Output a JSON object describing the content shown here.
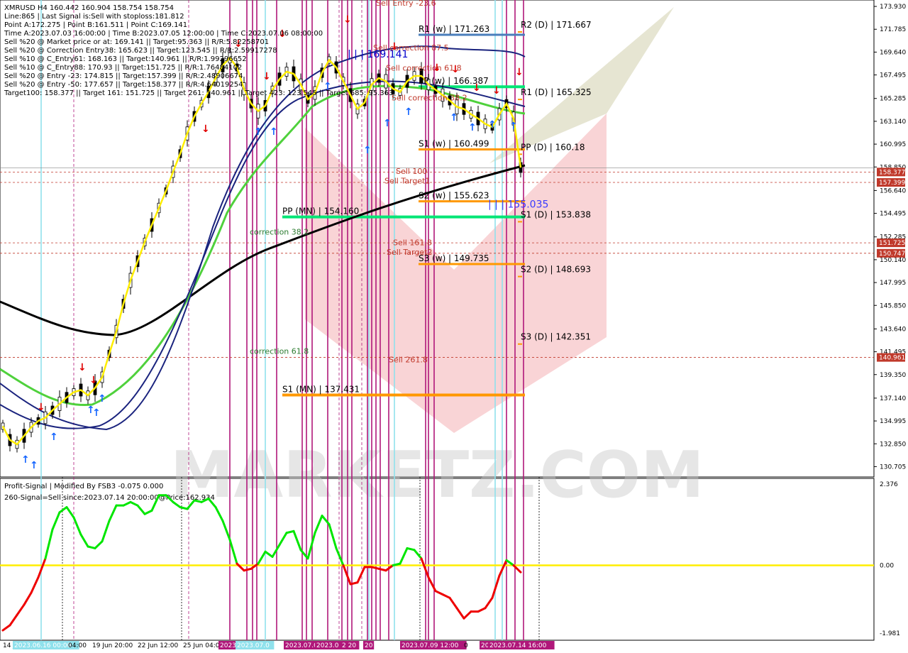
{
  "header": {
    "symbol_line": "XMRUSD H4  160.442 160.904 158.754 158.754",
    "info_lines": [
      "Line:865 | Last Signal is:Sell with stoploss:181.812",
      "Point A:172.275 | Point B:161.511 | Point C:169.141",
      "Time A:2023.07.03 16:00:00 | Time B:2023.07.05 12:00:00 | Time C:2023.07.06 08:00:00",
      "Sell %20 @ Market price or at: 169.141 || Target:95.363 || R/R:5.82258701",
      "Sell %20 @ Correction Entry38: 165.623 || Target:123.545 || R/R:2.59917278",
      "Sell %10 @ C_Entry61: 168.163 || Target:140.961 || R/R:1.99296652",
      "Sell %10 @ C_Entry88: 170.93 || Target:151.725 || R/R:1.76484102",
      "Sell %20 @ Entry -23: 174.815 || Target:157.399 || R/R:2.48906674",
      "Sell %20 @ Entry -50: 177.657 || Target:158.377 || R/R:4.64019254",
      "Target100: 158.377 || Target 161: 151.725 || Target 261: 140.961 || Target 423: 123.545 || Target 685: 95.363"
    ]
  },
  "chart_data": [
    {
      "type": "line",
      "title": "XMRUSD H4",
      "ylim": [
        130.0,
        174.0
      ],
      "y_ticks": [
        "173.930",
        "171.785",
        "169.640",
        "167.495",
        "165.285",
        "163.140",
        "160.995",
        "158.850",
        "156.640",
        "154.495",
        "152.285",
        "150.140",
        "147.995",
        "145.850",
        "143.640",
        "141.495",
        "139.350",
        "137.140",
        "134.995",
        "132.850",
        "130.705"
      ],
      "x_tick_labels": [
        "14 Jun",
        "2023.06.16 00:00",
        "04:00",
        "19 Jun 20:00",
        "22 Jun 12:00",
        "25 Jun 04:00",
        "2023",
        "2023.07.0",
        "2023.07.0",
        "2023.0",
        "2 20",
        "20",
        "2023.07.09 12:00",
        "0",
        "20",
        "2023.07.14 16:00"
      ],
      "price_tags": [
        {
          "label": "158.377",
          "value": 158.377,
          "color": "#c0392b"
        },
        {
          "label": "157.399",
          "value": 157.399,
          "color": "#c0392b"
        },
        {
          "label": "151.725",
          "value": 151.725,
          "color": "#c0392b"
        },
        {
          "label": "150.747",
          "value": 150.747,
          "color": "#c0392b"
        },
        {
          "label": "140.961",
          "value": 140.961,
          "color": "#c0392b"
        }
      ],
      "levels": [
        {
          "label": "R2 (D) | 171.667",
          "value": 171.667,
          "color": "#000000"
        },
        {
          "label": "R1 (w) | 171.263",
          "value": 171.263,
          "color": "#4a7ebb"
        },
        {
          "label": "PP (w) | 166.387",
          "value": 166.387,
          "color": "#00e676"
        },
        {
          "label": "R1 (D) | 165.325",
          "value": 165.325,
          "color": "#000000"
        },
        {
          "label": "S1 (w) | 160.499",
          "value": 160.499,
          "color": "#ff9800"
        },
        {
          "label": "PP (D) | 160.18",
          "value": 160.18,
          "color": "#000000"
        },
        {
          "label": "S2 (w) | 155.623",
          "value": 155.623,
          "color": "#ff9800"
        },
        {
          "label": "PP (MN) | 154.160",
          "value": 154.16,
          "color": "#00e676"
        },
        {
          "label": "S1 (D) | 153.838",
          "value": 153.838,
          "color": "#000000"
        },
        {
          "label": "S3 (w) | 149.735",
          "value": 149.735,
          "color": "#ff9800"
        },
        {
          "label": "S2 (D) | 148.693",
          "value": 148.693,
          "color": "#000000"
        },
        {
          "label": "S3 (D) | 142.351",
          "value": 142.351,
          "color": "#000000"
        },
        {
          "label": "S1 (MN) | 137.431",
          "value": 137.431,
          "color": "#ff9800"
        }
      ],
      "annotations": [
        {
          "text": "| | | 169.141",
          "value": 169.141,
          "color": "#0000cc"
        },
        {
          "text": "| | | 155.035",
          "value": 155.035,
          "color": "#0000cc"
        },
        {
          "text": "Sell Entry -23.6",
          "value": 174.0,
          "color": "#c0392b"
        },
        {
          "text": "Sell correction 87.5",
          "value": 169.8,
          "color": "#c0392b"
        },
        {
          "text": "Sell correction 61.8",
          "value": 167.9,
          "color": "#c0392b"
        },
        {
          "text": "Sell correction 38.2",
          "value": 165.1,
          "color": "#c0392b"
        },
        {
          "text": "Sell 100",
          "value": 158.2,
          "color": "#c0392b"
        },
        {
          "text": "Sell Target1",
          "value": 157.3,
          "color": "#c0392b"
        },
        {
          "text": "Sell 161.8",
          "value": 151.5,
          "color": "#c0392b"
        },
        {
          "text": "Sell Target2",
          "value": 150.6,
          "color": "#c0392b"
        },
        {
          "text": "Sell 261.8",
          "value": 140.5,
          "color": "#c0392b"
        },
        {
          "text": "correction 38.2",
          "value": 152.5,
          "color": "#2e7d32"
        },
        {
          "text": "correction 61.8",
          "value": 141.3,
          "color": "#2e7d32"
        }
      ],
      "series": [
        {
          "name": "XMRUSD H4",
          "color": "#ffee00",
          "x": [
            0,
            10,
            20,
            30,
            40,
            50,
            60,
            70,
            80,
            90,
            100,
            110,
            120,
            130,
            140,
            150,
            160,
            170,
            180,
            190,
            200,
            210,
            220,
            230,
            240,
            250,
            260,
            270,
            280,
            290,
            300,
            310,
            320,
            330,
            340,
            350,
            360,
            370,
            380,
            390,
            400,
            410,
            420,
            430,
            440,
            450,
            460,
            470,
            480,
            490,
            500,
            510,
            520,
            530,
            540,
            550,
            560,
            570,
            580,
            590,
            600,
            610,
            620,
            630,
            640,
            650,
            660,
            670,
            680,
            690,
            700,
            710,
            720,
            730
          ],
          "values": [
            134.5,
            133.2,
            132.8,
            133.6,
            134.4,
            135.0,
            135.3,
            136.0,
            136.6,
            137.2,
            137.7,
            137.9,
            137.4,
            138.1,
            139.1,
            141.3,
            143.4,
            146.0,
            148.2,
            150.0,
            151.8,
            153.4,
            155.0,
            156.6,
            158.4,
            160.1,
            162.0,
            163.6,
            164.8,
            165.9,
            167.2,
            168.4,
            169.1,
            168.2,
            166.2,
            164.8,
            164.1,
            164.6,
            166.1,
            167.1,
            167.8,
            167.6,
            166.6,
            165.2,
            165.8,
            167.7,
            168.9,
            168.2,
            166.9,
            165.6,
            164.3,
            164.9,
            166.6,
            167.2,
            166.9,
            166.2,
            165.9,
            166.9,
            167.4,
            167.4,
            166.6,
            166.1,
            165.6,
            165.1,
            164.5,
            164.3,
            163.8,
            163.4,
            162.9,
            162.6,
            163.8,
            164.8,
            163.4,
            158.8
          ]
        },
        {
          "name": "Profit-Signal",
          "color": "#00e600",
          "x": [
            0,
            10,
            20,
            30,
            40,
            50,
            60,
            70,
            80,
            90,
            100,
            110,
            120,
            130,
            140,
            150,
            160,
            170,
            180,
            190,
            200,
            210,
            220,
            230,
            240,
            250,
            260,
            270,
            280,
            290,
            300,
            310,
            320,
            330,
            340,
            350,
            360,
            370,
            380,
            390,
            400,
            410,
            420,
            430,
            440,
            450,
            460,
            470,
            480,
            490,
            500,
            510,
            520,
            530,
            540,
            550,
            560,
            570,
            580,
            590,
            600,
            610,
            620,
            630,
            640,
            650,
            660,
            670,
            680,
            690,
            700,
            710,
            720,
            730
          ],
          "values": [
            -1.9,
            -1.75,
            -1.45,
            -1.15,
            -0.8,
            -0.35,
            0.2,
            1.05,
            1.55,
            1.7,
            1.4,
            0.9,
            0.55,
            0.5,
            0.7,
            1.3,
            1.75,
            1.75,
            1.85,
            1.75,
            1.5,
            1.6,
            2.05,
            2.05,
            1.85,
            1.7,
            1.65,
            1.9,
            1.85,
            1.95,
            1.7,
            1.3,
            0.75,
            0.05,
            -0.15,
            -0.1,
            0.05,
            0.4,
            0.25,
            0.6,
            0.95,
            1.0,
            0.45,
            0.2,
            0.95,
            1.45,
            1.2,
            0.5,
            0.0,
            -0.55,
            -0.5,
            -0.05,
            -0.05,
            -0.1,
            -0.15,
            0.0,
            0.05,
            0.5,
            0.45,
            0.2,
            -0.35,
            -0.75,
            -0.85,
            -0.95,
            -1.25,
            -1.55,
            -1.35,
            -1.35,
            -1.25,
            -0.95,
            -0.3,
            0.15,
            0.0,
            -0.2
          ]
        }
      ]
    },
    {
      "type": "line",
      "title": "Profit-Signal | Modified By FSB3 -0.075 0.000",
      "subtitle": "260-Signal=Sell since:2023.07.14 20:00:00@Price:162.934",
      "ylim": [
        -1.981,
        2.376
      ],
      "y_ticks": [
        "2.376",
        "0.00",
        "-1.981"
      ],
      "zero_line_color": "#ffee00"
    }
  ],
  "watermark": "MARKETZ.COM"
}
